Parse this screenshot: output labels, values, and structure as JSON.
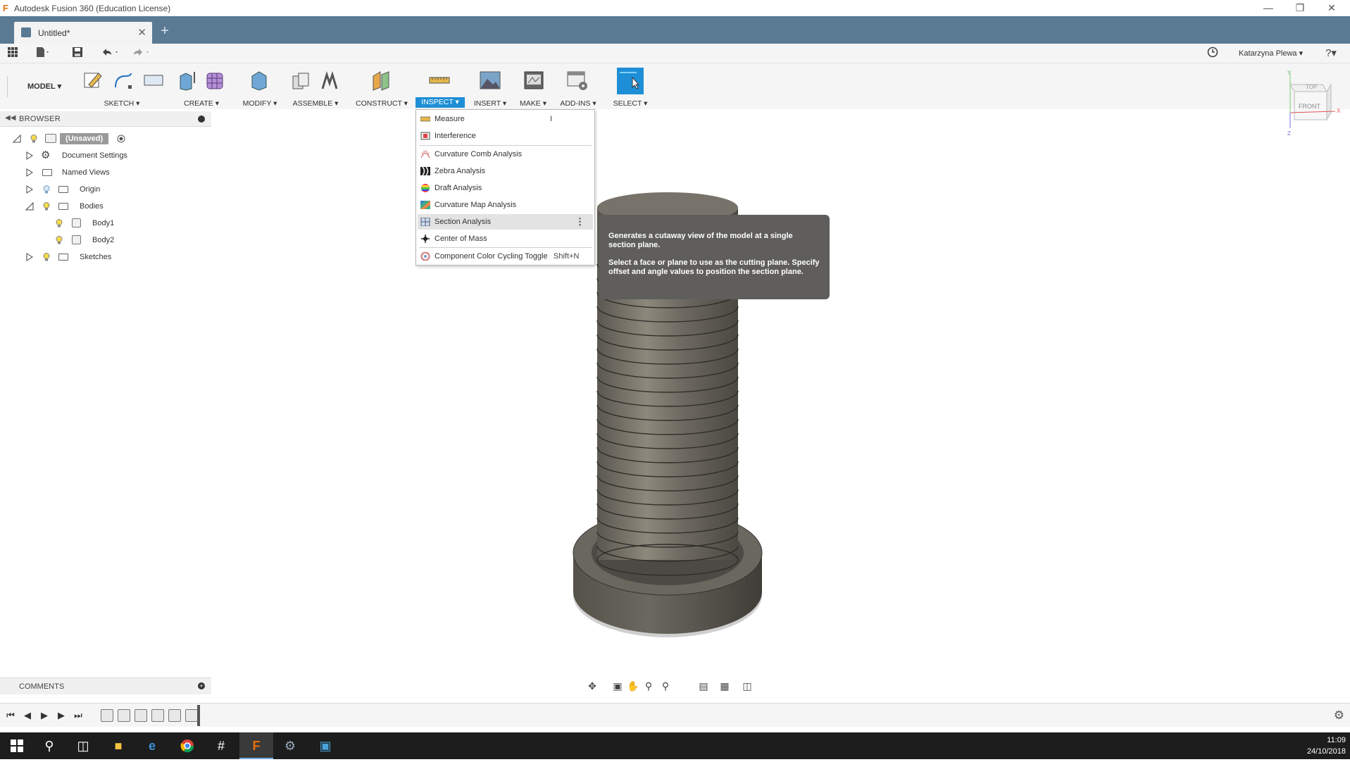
{
  "window": {
    "title": "Autodesk Fusion 360 (Education License)",
    "logo_letter": "F"
  },
  "tab": {
    "label": "Untitled*",
    "close": "✕",
    "new": "+"
  },
  "quickbar": {
    "user": "Katarzyna Plewa ▾",
    "help": "?▾"
  },
  "ribbon": {
    "workspace": "MODEL ▾",
    "groups": [
      {
        "label": "SKETCH ▾"
      },
      {
        "label": "CREATE ▾"
      },
      {
        "label": "MODIFY ▾"
      },
      {
        "label": "ASSEMBLE ▾"
      },
      {
        "label": "CONSTRUCT ▾"
      },
      {
        "label": "INSPECT ▾"
      },
      {
        "label": "INSERT ▾"
      },
      {
        "label": "MAKE ▾"
      },
      {
        "label": "ADD-INS ▾"
      },
      {
        "label": "SELECT ▾"
      }
    ]
  },
  "browser": {
    "title": "BROWSER",
    "items": [
      {
        "label": "(Unsaved)"
      },
      {
        "label": "Document Settings"
      },
      {
        "label": "Named Views"
      },
      {
        "label": "Origin"
      },
      {
        "label": "Bodies"
      },
      {
        "label": "Body1"
      },
      {
        "label": "Body2"
      },
      {
        "label": "Sketches"
      }
    ]
  },
  "inspect_menu": {
    "items": [
      {
        "label": "Measure",
        "shortcut": "I"
      },
      {
        "label": "Interference",
        "shortcut": ""
      },
      {
        "label": "Curvature Comb Analysis",
        "shortcut": ""
      },
      {
        "label": "Zebra Analysis",
        "shortcut": ""
      },
      {
        "label": "Draft Analysis",
        "shortcut": ""
      },
      {
        "label": "Curvature Map Analysis",
        "shortcut": ""
      },
      {
        "label": "Section Analysis",
        "shortcut": ""
      },
      {
        "label": "Center of Mass",
        "shortcut": ""
      },
      {
        "label": "Component Color Cycling Toggle",
        "shortcut": "Shift+N"
      }
    ],
    "more": "⋮"
  },
  "tooltip": {
    "line1": "Generates a cutaway view of the model at a single section plane.",
    "line2": "Select a face or plane to use as the cutting plane. Specify offset and angle values to position the section plane."
  },
  "viewcube": {
    "top": "TOP",
    "front": "FRONT",
    "x": "X",
    "y": "Y",
    "z": "Z"
  },
  "comments": {
    "title": "COMMENTS"
  },
  "taskbar": {
    "time": "11:09",
    "date": "24/10/2018"
  },
  "colors": {
    "tabbar": "#5a7a94",
    "accent": "#1e8fd6",
    "tooltip": "#5f5e5c",
    "taskbar": "#1d1d1d"
  }
}
